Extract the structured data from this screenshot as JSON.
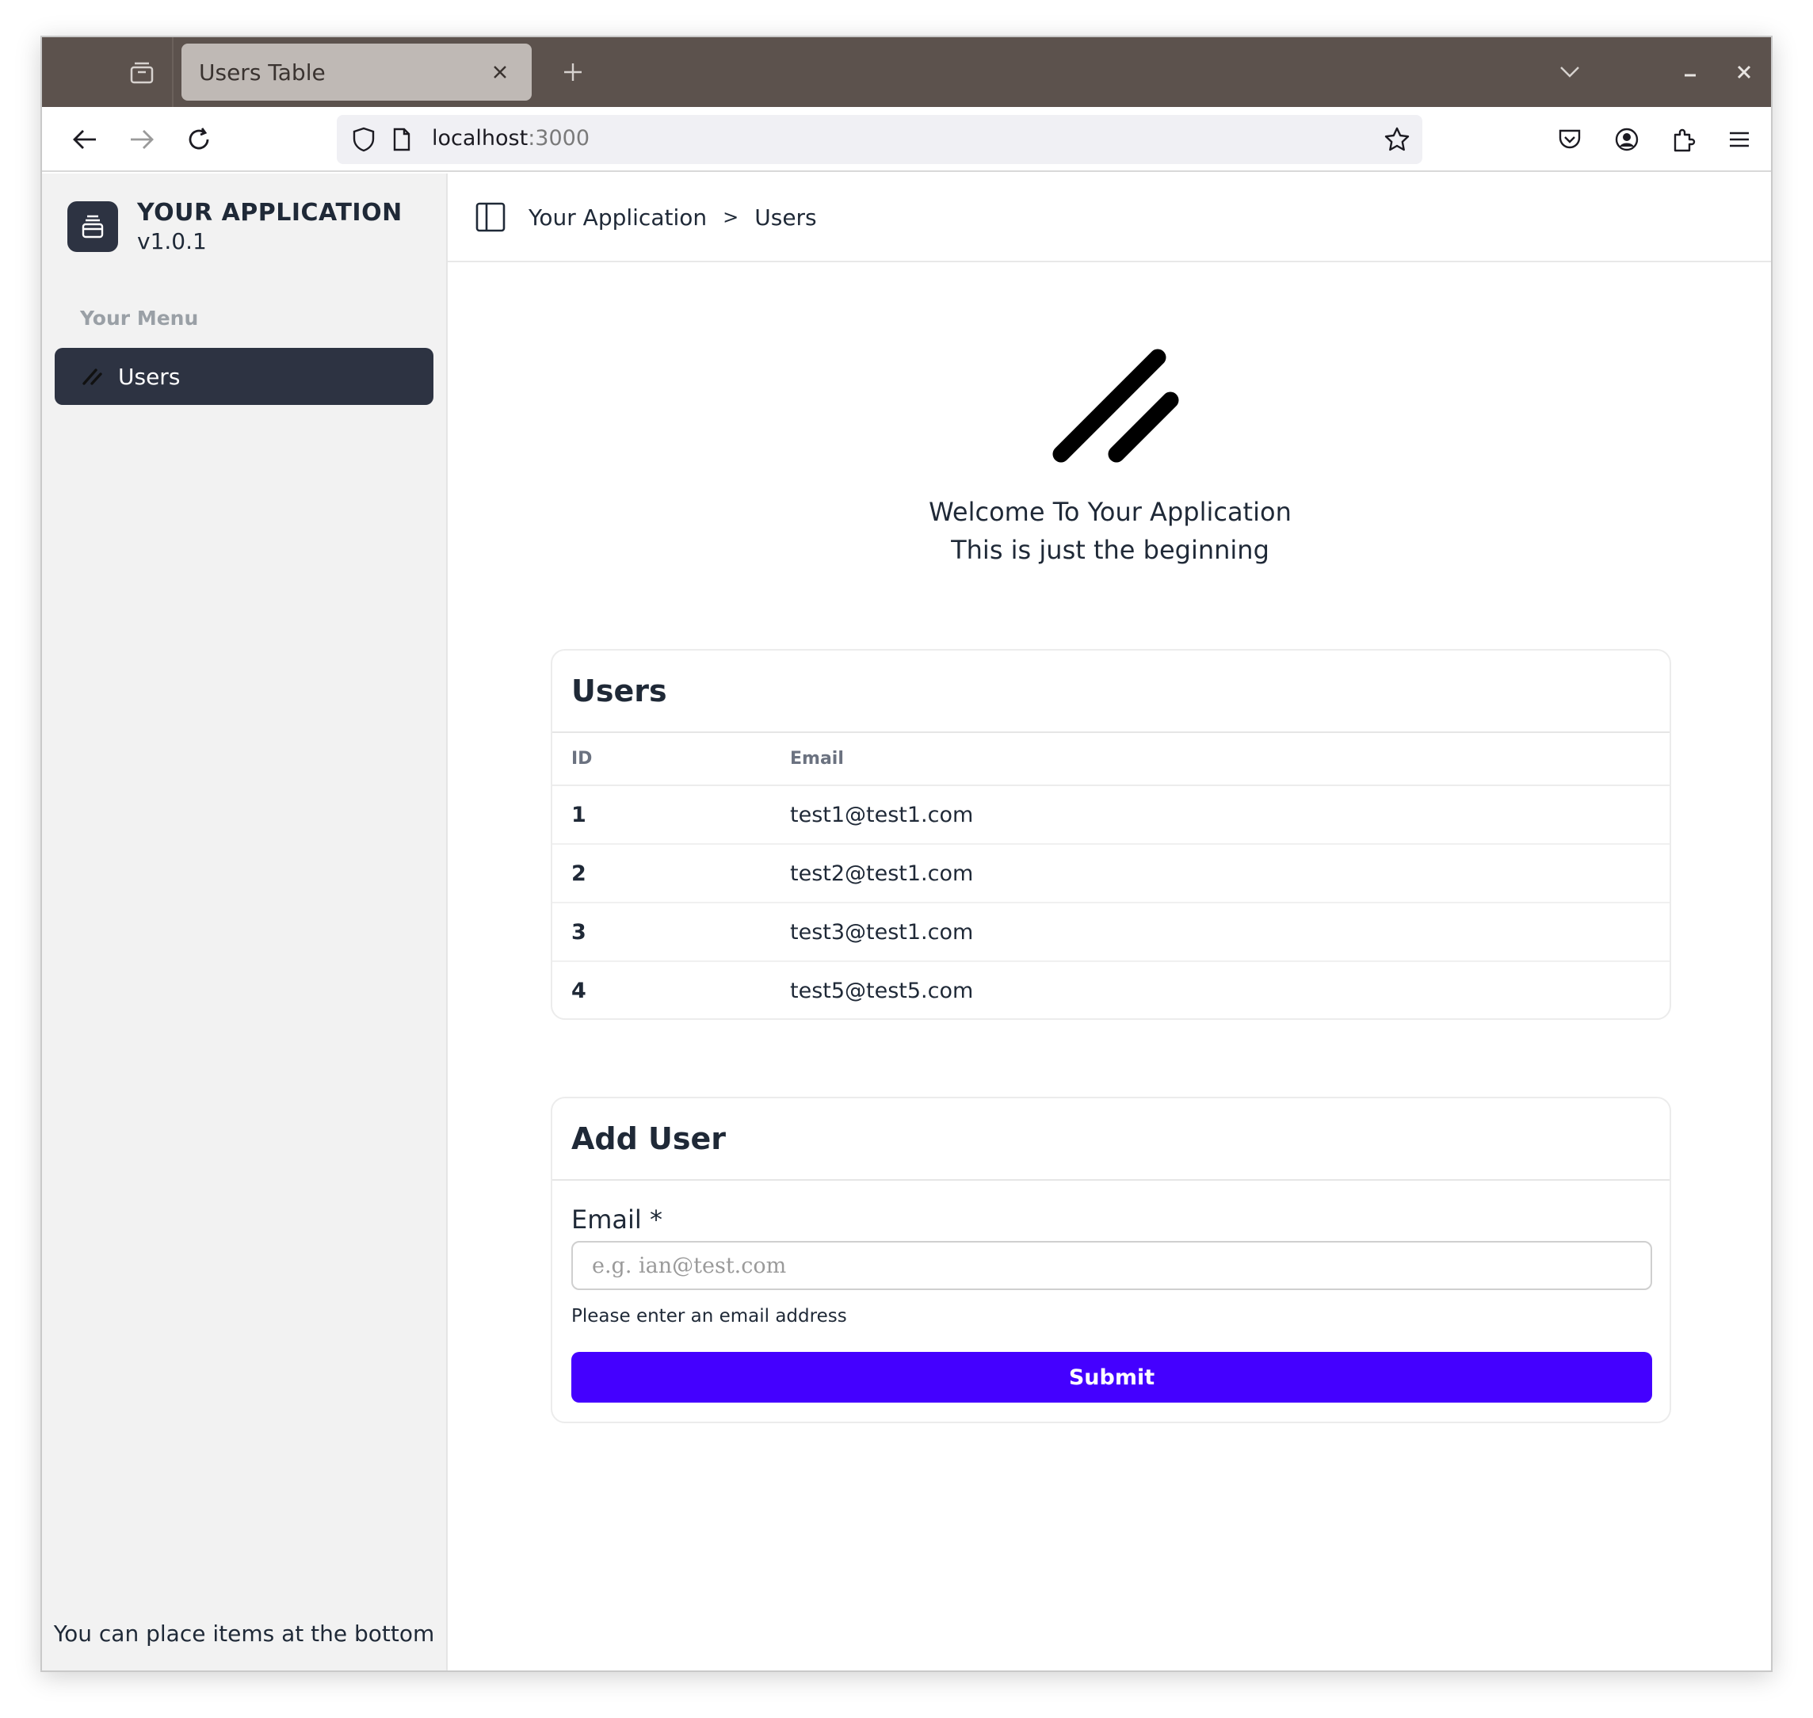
{
  "browser": {
    "tab_title": "Users Table",
    "url_host": "localhost",
    "url_port": ":3000",
    "icons": {
      "collections": "collections-icon",
      "tab_close": "close-icon",
      "new_tab": "plus-icon",
      "tab_list": "chevron-down-icon",
      "minimize": "minimize-icon",
      "close": "close-icon",
      "back": "back-arrow-icon",
      "forward": "forward-arrow-icon",
      "reload": "reload-icon",
      "shield": "shield-icon",
      "page": "page-icon",
      "bookmark": "star-icon",
      "pocket": "pocket-icon",
      "account": "account-icon",
      "extensions": "puzzle-icon",
      "menu": "hamburger-menu-icon"
    }
  },
  "sidebar": {
    "brand_name": "YOUR APPLICATION",
    "brand_version": "v1.0.1",
    "menu_label": "Your Menu",
    "items": [
      {
        "label": "Users",
        "icon": "double-slash-icon",
        "active": true
      }
    ],
    "bottom_text": "You can place items at the bottom"
  },
  "header": {
    "breadcrumbs": [
      "Your Application",
      "Users"
    ],
    "separator": ">"
  },
  "hero": {
    "title": "Welcome To Your Application",
    "subtitle": "This is just the beginning"
  },
  "users_table": {
    "title": "Users",
    "columns": [
      "ID",
      "Email"
    ],
    "rows": [
      {
        "id": "1",
        "email": "test1@test1.com"
      },
      {
        "id": "2",
        "email": "test2@test1.com"
      },
      {
        "id": "3",
        "email": "test3@test1.com"
      },
      {
        "id": "4",
        "email": "test5@test5.com"
      }
    ]
  },
  "add_user": {
    "title": "Add User",
    "email_label": "Email *",
    "email_placeholder": "e.g. ian@test.com",
    "email_value": "",
    "help_text": "Please enter an email address",
    "submit_label": "Submit"
  },
  "colors": {
    "tabbar": "#5c524d",
    "sidebar_active": "#2d3342",
    "submit_button": "#4400ff"
  }
}
